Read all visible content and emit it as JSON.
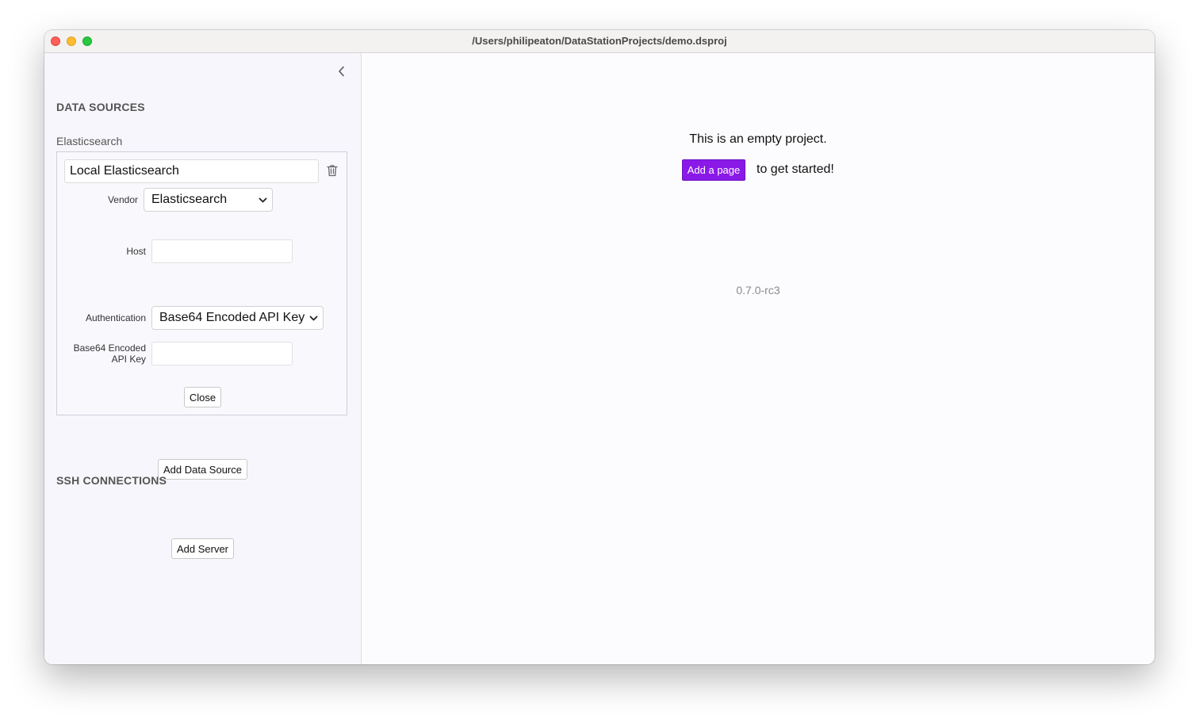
{
  "window": {
    "title": "/Users/philipeaton/DataStationProjects/demo.dsproj"
  },
  "sidebar": {
    "collapse_icon": "chevron-left-icon",
    "data_sources": {
      "title": "DATA SOURCES",
      "group_label": "Elasticsearch",
      "item": {
        "name_value": "Local Elasticsearch",
        "delete_icon": "trash-icon",
        "vendor_label": "Vendor",
        "vendor_value": "Elasticsearch",
        "host_label": "Host",
        "host_value": "",
        "auth_label": "Authentication",
        "auth_value": "Base64 Encoded API Key",
        "api_key_label_line1": "Base64 Encoded",
        "api_key_label_line2": "API Key",
        "api_key_value": "",
        "close_label": "Close"
      },
      "add_label": "Add Data Source"
    },
    "ssh": {
      "title": "SSH CONNECTIONS",
      "add_label": "Add Server"
    }
  },
  "main": {
    "empty_message": "This is an empty project.",
    "add_page_label": "Add a page",
    "get_started_text": "to get started!",
    "version": "0.7.0-rc3"
  },
  "colors": {
    "accent": "#8a19e8",
    "sidebar_bg": "#f7f6fc",
    "main_bg": "#fcfcfe"
  }
}
